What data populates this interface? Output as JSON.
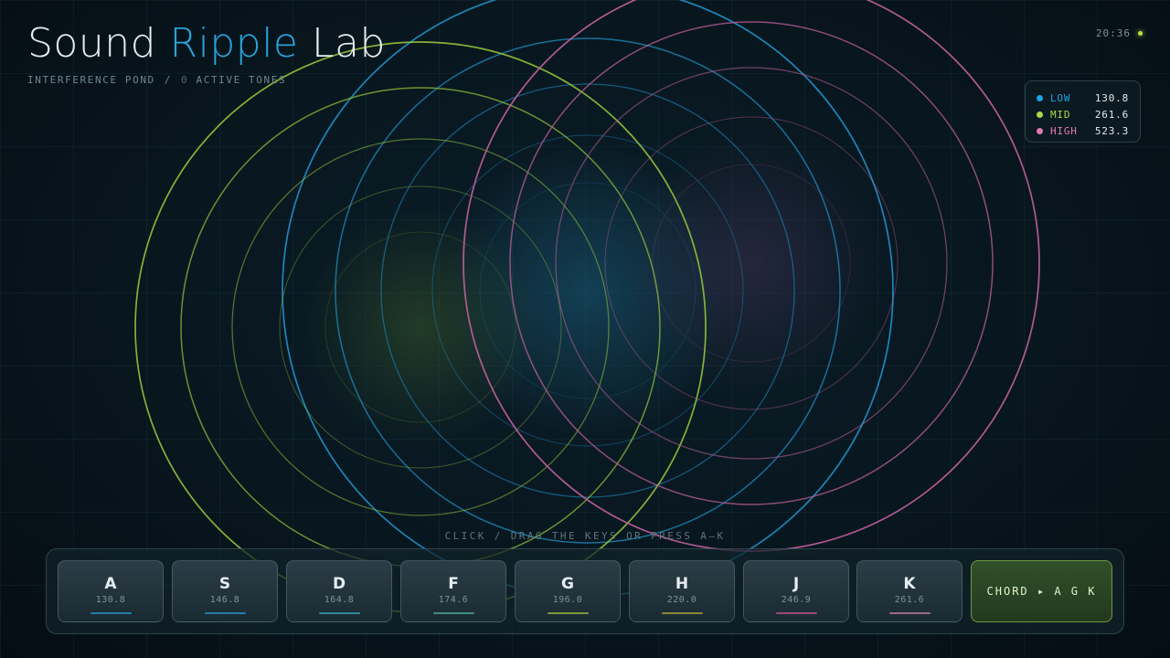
{
  "app": {
    "title_part1": "Sound ",
    "title_accent": "Ripple",
    "title_part2": " Lab",
    "subtitle_mode": "INTERFERENCE POND",
    "subtitle_sep": "/",
    "subtitle_count": "0",
    "subtitle_count_label": "ACTIVE TONES",
    "clock": "20:36"
  },
  "legend": [
    {
      "name": "LOW",
      "value": "130.8",
      "color": "#1fa3e6"
    },
    {
      "name": "MID",
      "value": "261.6",
      "color": "#a8d94a"
    },
    {
      "name": "HIGH",
      "value": "523.3",
      "color": "#e07ab4"
    }
  ],
  "hint": "CLICK / DRAG THE KEYS OR PRESS A–K",
  "keys": [
    {
      "letter": "A",
      "freq": "130.8",
      "color": "#1f7fa8"
    },
    {
      "letter": "S",
      "freq": "146.8",
      "color": "#1f7fa8"
    },
    {
      "letter": "D",
      "freq": "164.8",
      "color": "#2a8c9a"
    },
    {
      "letter": "F",
      "freq": "174.6",
      "color": "#3f8f7a"
    },
    {
      "letter": "G",
      "freq": "196.0",
      "color": "#7a9a3a"
    },
    {
      "letter": "H",
      "freq": "220.0",
      "color": "#8a8a3a"
    },
    {
      "letter": "J",
      "freq": "246.9",
      "color": "#9a4a7a"
    },
    {
      "letter": "K",
      "freq": "261.6",
      "color": "#9a6a8a"
    }
  ],
  "chord_label": "CHORD ▸ A G K",
  "ripples": [
    {
      "band": "LOW",
      "color": "#1f8fc8"
    },
    {
      "band": "MID",
      "color": "#8fbf3a"
    },
    {
      "band": "HIGH",
      "color": "#c0609a"
    }
  ]
}
